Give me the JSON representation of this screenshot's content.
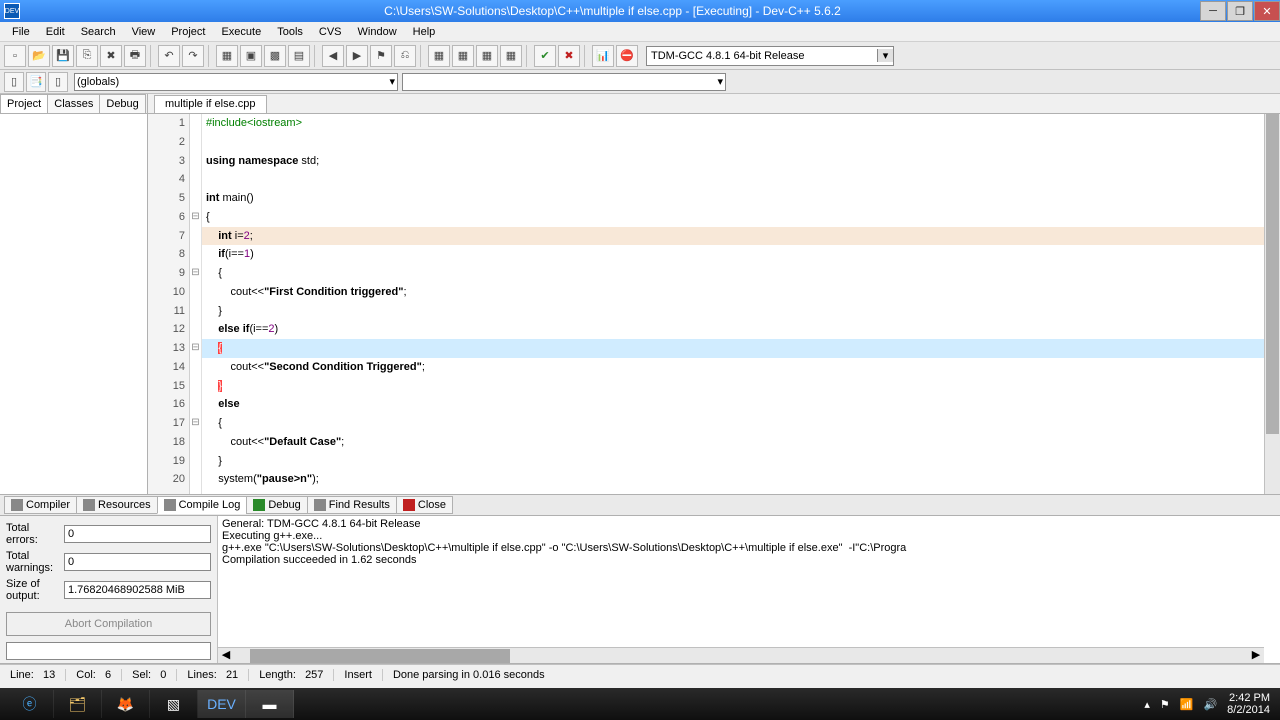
{
  "title": "C:\\Users\\SW-Solutions\\Desktop\\C++\\multiple if else.cpp - [Executing] - Dev-C++ 5.6.2",
  "menu": [
    "File",
    "Edit",
    "Search",
    "View",
    "Project",
    "Execute",
    "Tools",
    "CVS",
    "Window",
    "Help"
  ],
  "compiler_select": "TDM-GCC 4.8.1 64-bit Release",
  "scope_select": "(globals)",
  "left_tabs": [
    "Project",
    "Classes",
    "Debug"
  ],
  "file_tab": "multiple if else.cpp",
  "code": {
    "l1a": "#include",
    "l1b": "<iostream>",
    "l3a": "using",
    "l3b": "namespace",
    "l3c": "std;",
    "l5a": "int",
    "l5b": "main()",
    "l6": "{",
    "l7a": "int",
    "l7b": "i=",
    "l7c": "2",
    "l7d": ";",
    "l8a": "if",
    "l8b": "(i==",
    "l8c": "1",
    "l8d": ")",
    "l9": "{",
    "l10a": "cout<<",
    "l10b": "\"First Condition triggered\"",
    "l10c": ";",
    "l11": "}",
    "l12a": "else",
    "l12b": "if",
    "l12c": "(i==",
    "l12d": "2",
    "l12e": ")",
    "l13": "{",
    "l14a": "cout<<",
    "l14b": "\"Second Condition Triggered\"",
    "l14c": ";",
    "l15": "}",
    "l16": "else",
    "l17": "{",
    "l18a": "cout<<",
    "l18b": "\"Default Case\"",
    "l18c": ";",
    "l19": "}",
    "l20a": "system(",
    "l20b": "\"pause>n\"",
    "l20c": ");"
  },
  "linenums": {
    "n1": "1",
    "n2": "2",
    "n3": "3",
    "n4": "4",
    "n5": "5",
    "n6": "6",
    "n7": "7",
    "n8": "8",
    "n9": "9",
    "n10": "10",
    "n11": "11",
    "n12": "12",
    "n13": "13",
    "n14": "14",
    "n15": "15",
    "n16": "16",
    "n17": "17",
    "n18": "18",
    "n19": "19",
    "n20": "20"
  },
  "bottom_tabs": [
    "Compiler",
    "Resources",
    "Compile Log",
    "Debug",
    "Find Results",
    "Close"
  ],
  "compile_panel": {
    "errors_label": "Total errors:",
    "errors": "0",
    "warnings_label": "Total warnings:",
    "warnings": "0",
    "size_label": "Size of output:",
    "size": "1.76820468902588 MiB",
    "abort": "Abort Compilation"
  },
  "log": {
    "l1": "General: TDM-GCC 4.8.1 64-bit Release",
    "l2": "Executing g++.exe...",
    "l3": "g++.exe \"C:\\Users\\SW-Solutions\\Desktop\\C++\\multiple if else.cpp\" -o \"C:\\Users\\SW-Solutions\\Desktop\\C++\\multiple if else.exe\"  -I\"C:\\Progra",
    "l4": "Compilation succeeded in 1.62 seconds"
  },
  "status": {
    "line_lbl": "Line:",
    "line": "13",
    "col_lbl": "Col:",
    "col": "6",
    "sel_lbl": "Sel:",
    "sel": "0",
    "lines_lbl": "Lines:",
    "lines": "21",
    "len_lbl": "Length:",
    "len": "257",
    "ins": "Insert",
    "parse": "Done parsing in 0.016 seconds"
  },
  "clock": {
    "time": "2:42 PM",
    "date": "8/2/2014"
  }
}
